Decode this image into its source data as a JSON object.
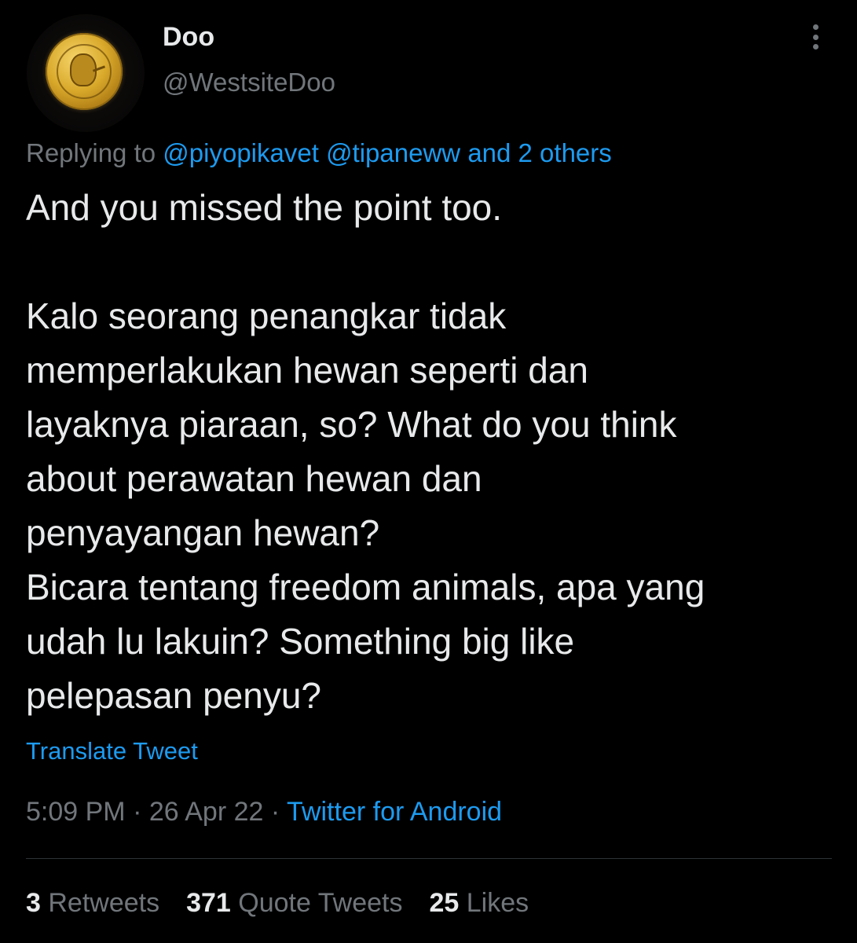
{
  "author": {
    "display_name": "Doo",
    "username": "@WestsiteDoo",
    "avatar_icon": "gold-coin-avatar"
  },
  "reply": {
    "prefix": "Replying to",
    "mentions": [
      "@piyopikavet",
      "@tipaneww"
    ],
    "suffix": "and 2 others"
  },
  "tweet": {
    "lines": [
      "And you missed the point too.",
      "",
      "Kalo seorang penangkar tidak",
      "memperlakukan hewan seperti dan",
      "layaknya piaraan, so? What do you think",
      "about perawatan hewan dan",
      "penyayangan hewan?",
      "Bicara tentang freedom animals, apa yang",
      "udah lu lakuin? Something big like",
      "pelepasan penyu?"
    ]
  },
  "translate_label": "Translate Tweet",
  "meta": {
    "time": "5:09 PM",
    "separator": "·",
    "date": "26 Apr 22",
    "source": "Twitter for Android"
  },
  "stats": {
    "retweets_count": "3",
    "retweets_label": "Retweets",
    "quotes_count": "371",
    "quotes_label": "Quote Tweets",
    "likes_count": "25",
    "likes_label": "Likes"
  },
  "colors": {
    "background": "#000000",
    "text": "#e7e9ea",
    "secondary": "#71767b",
    "link": "#1d9bf0"
  }
}
